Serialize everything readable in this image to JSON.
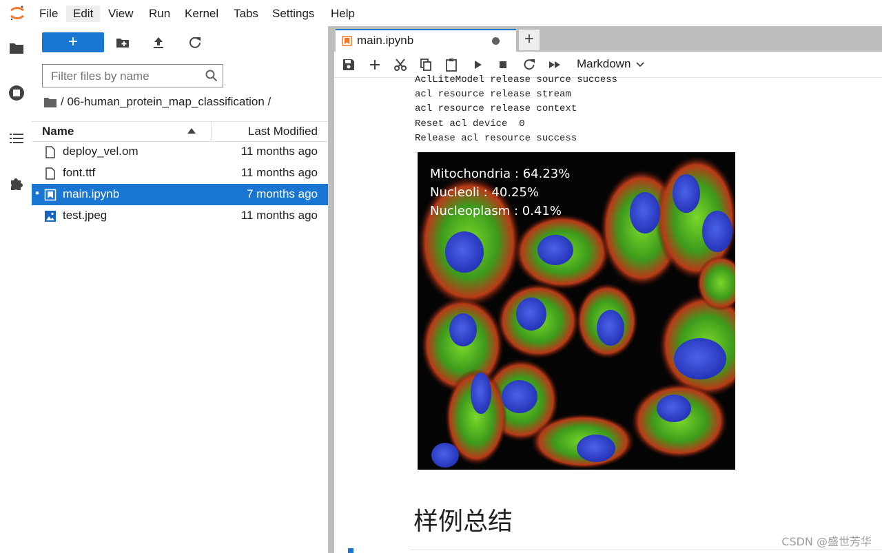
{
  "menubar": {
    "items": [
      "File",
      "Edit",
      "View",
      "Run",
      "Kernel",
      "Tabs",
      "Settings",
      "Help"
    ],
    "active": "Edit"
  },
  "activitybar": {
    "icons": [
      "folder-icon",
      "running-icon",
      "toc-icon",
      "extension-icon"
    ]
  },
  "filebrowser": {
    "new_label": "+",
    "filter_placeholder": "Filter files by name",
    "breadcrumb": "/ 06-human_protein_map_classification /",
    "col_name": "Name",
    "col_modified": "Last Modified",
    "files": [
      {
        "name": "deploy_vel.om",
        "modified": "11 months ago",
        "type": "file",
        "selected": false
      },
      {
        "name": "font.ttf",
        "modified": "11 months ago",
        "type": "file",
        "selected": false
      },
      {
        "name": "main.ipynb",
        "modified": "7 months ago",
        "type": "notebook",
        "selected": true
      },
      {
        "name": "test.jpeg",
        "modified": "11 months ago",
        "type": "image",
        "selected": false
      }
    ],
    "selected_marker": "•"
  },
  "tabs": [
    {
      "label": "main.ipynb",
      "dirty": true
    }
  ],
  "add_tab_label": "+",
  "notebook_toolbar": {
    "cell_type": "Markdown"
  },
  "output": {
    "lines": [
      "AclLiteModel release source success",
      "acl resource release stream",
      "acl resource release context",
      "Reset acl device  0",
      "Release acl resource success"
    ],
    "image_labels": [
      "Mitochondria : 64.23%",
      "Nucleoli : 40.25%",
      "Nucleoplasm : 0.41%"
    ]
  },
  "heading": "样例总结",
  "watermark": "CSDN @盛世芳华",
  "colors": {
    "accent": "#1976d2",
    "selection_text": "#ffffff",
    "nucleus": "#3a4fd6",
    "green_stain": "#4cc01e",
    "red_stain": "#c8321e"
  }
}
